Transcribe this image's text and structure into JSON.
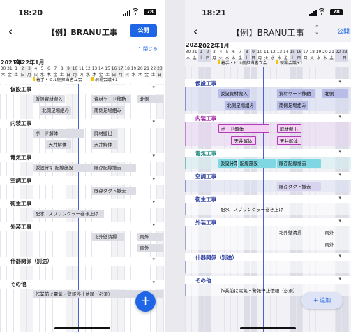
{
  "left": {
    "status_time": "18:20",
    "battery": "78",
    "title": "【例】BRANU工事",
    "publish_label": "公開",
    "close_label": "⌃ 閉じる",
    "fab_label": "+",
    "months": [
      {
        "label": "2021年",
        "col": 0
      },
      {
        "label": "2022年1月",
        "col": 2
      }
    ],
    "days": [
      "30",
      "31",
      "1",
      "2",
      "3",
      "4",
      "5",
      "6",
      "7",
      "8",
      "9",
      "10",
      "11",
      "12",
      "13",
      "14",
      "15",
      "16",
      "17",
      "18",
      "19",
      "20",
      "21",
      "22",
      "23"
    ],
    "weekdays": [
      "木",
      "金",
      "土",
      "日",
      "月",
      "火",
      "水",
      "木",
      "金",
      "土",
      "日",
      "月",
      "火",
      "水",
      "木",
      "金",
      "土",
      "日",
      "月",
      "火",
      "水",
      "木",
      "金",
      "土",
      "日"
    ],
    "weekend_cols": [
      3,
      4,
      10,
      11,
      17,
      18,
      24
    ],
    "today_col": 12,
    "events": [
      {
        "col": 5,
        "text": "着手・ビル側担当者立会"
      },
      {
        "col": 14,
        "text": "現場会議+1"
      }
    ],
    "groups": [
      {
        "name": "仮設工事"
      },
      {
        "name": "内装工事"
      },
      {
        "name": "電気工事"
      },
      {
        "name": "空調工事"
      },
      {
        "name": "衛生工事"
      },
      {
        "name": "外装工事"
      },
      {
        "name": "什器関係（別途）"
      },
      {
        "name": "その他"
      }
    ],
    "tasks": [
      {
        "label": "仮設資材搬入",
        "col": 5,
        "span": 5,
        "row": 0,
        "group": 0
      },
      {
        "label": "資材ヤード移動",
        "col": 14,
        "span": 6,
        "row": 0,
        "group": 0
      },
      {
        "label": "北側",
        "col": 21,
        "span": 4,
        "row": 0,
        "group": 0
      },
      {
        "label": "北側足場組み",
        "col": 6,
        "span": 5,
        "row": 1,
        "group": 0
      },
      {
        "label": "南側足場組み",
        "col": 14,
        "span": 5,
        "row": 1,
        "group": 0
      },
      {
        "label": "ボード解体",
        "col": 5,
        "span": 8,
        "row": 0,
        "group": 1
      },
      {
        "label": "廃材搬出",
        "col": 14,
        "span": 4,
        "row": 0,
        "group": 1
      },
      {
        "label": "天井解体",
        "col": 7,
        "span": 4,
        "row": 1,
        "group": 1
      },
      {
        "label": "天井解体",
        "col": 14,
        "span": 4,
        "row": 1,
        "group": 1
      },
      {
        "label": "仮設分電",
        "col": 5,
        "span": 3,
        "row": 0,
        "group": 2
      },
      {
        "label": "配線施設",
        "col": 8,
        "span": 6,
        "row": 0,
        "group": 2
      },
      {
        "label": "既存配線撤去",
        "col": 14,
        "span": 7,
        "row": 0,
        "group": 2
      },
      {
        "label": "既存ダクト撤去",
        "col": 14,
        "span": 7,
        "row": 0,
        "group": 3
      },
      {
        "label": "配水",
        "col": 5,
        "span": 2,
        "row": 0,
        "group": 4
      },
      {
        "label": "スプリンクラー巻き上げ",
        "col": 7,
        "span": 9,
        "row": 0,
        "group": 4
      },
      {
        "label": "北外壁清掃",
        "col": 14,
        "span": 5,
        "row": 0,
        "group": 5
      },
      {
        "label": "南外",
        "col": 21,
        "span": 4,
        "row": 0,
        "group": 5
      },
      {
        "label": "南外",
        "col": 21,
        "span": 4,
        "row": 1,
        "group": 5
      },
      {
        "label": "作業前に電気・警報停止依頼（必須）",
        "col": 5,
        "span": 20,
        "row": 0,
        "group": 7
      }
    ]
  },
  "right": {
    "status_time": "18:21",
    "battery": "78",
    "title": "【例】BRANU工事",
    "publish_label": "公開",
    "collapse_icon": "⌃⌄",
    "add_label": "+ 追加",
    "months": [
      {
        "label": "2021",
        "col": 0
      },
      {
        "label": "2022年1月",
        "col": 2
      }
    ],
    "days": [
      "30",
      "31",
      "1",
      "2",
      "3",
      "4",
      "5",
      "6",
      "7",
      "8",
      "9",
      "10",
      "11",
      "12",
      "13",
      "14",
      "15",
      "16",
      "17",
      "18",
      "19",
      "20",
      "21",
      "22",
      "23"
    ],
    "weekdays": [
      "木",
      "金",
      "土",
      "日",
      "月",
      "火",
      "水",
      "木",
      "金",
      "土",
      "日",
      "月",
      "火",
      "水",
      "木",
      "金",
      "土",
      "日",
      "月",
      "火",
      "水",
      "木",
      "金",
      "土",
      "日"
    ],
    "weekend_cols": [
      2,
      3,
      9,
      10,
      16,
      17,
      23,
      24
    ],
    "today_col": 12,
    "events": [
      {
        "col": 5,
        "text": "着手・ビル側担当者立会"
      },
      {
        "col": 14,
        "text": "現場会議+1"
      }
    ],
    "groups": [
      {
        "name": "仮設工事",
        "color": "#2b3d9e",
        "stripe": "#d6daf2"
      },
      {
        "name": "内装工事",
        "color": "#9b1fa0",
        "stripe": "#ead6f3"
      },
      {
        "name": "電気工事",
        "color": "#14857a",
        "stripe": "#d4eeee"
      },
      {
        "name": "空調工事",
        "color": "#2b3d9e",
        "stripe": "#dfe2f4"
      },
      {
        "name": "衛生工事",
        "color": "#2b3d9e",
        "stripe": "#ffffff"
      },
      {
        "name": "外装工事",
        "color": "#2b3d9e",
        "stripe": "#ffffff"
      },
      {
        "name": "什器関係（別途）",
        "color": "#2b3d9e",
        "stripe": "#ffffff"
      },
      {
        "name": "その他",
        "color": "#2b3d9e",
        "stripe": "#ffffff"
      }
    ],
    "tasks": [
      {
        "label": "仮設資材搬入",
        "col": 5,
        "span": 5,
        "row": 0,
        "group": 0,
        "style": "blue"
      },
      {
        "label": "資材ヤード移動",
        "col": 14,
        "span": 6,
        "row": 0,
        "group": 0,
        "style": "blue"
      },
      {
        "label": "北側",
        "col": 21,
        "span": 4,
        "row": 0,
        "group": 0,
        "style": "blue"
      },
      {
        "label": "北側足場組み",
        "col": 6,
        "span": 5,
        "row": 1,
        "group": 0,
        "style": "blue"
      },
      {
        "label": "南側足場組み",
        "col": 14,
        "span": 5,
        "row": 1,
        "group": 0,
        "style": "blue"
      },
      {
        "label": "ボード解体",
        "col": 5,
        "span": 8,
        "row": 0,
        "group": 1,
        "style": "pink"
      },
      {
        "label": "廃材搬出",
        "col": 14,
        "span": 4,
        "row": 0,
        "group": 1,
        "style": "pink"
      },
      {
        "label": "天井解体",
        "col": 7,
        "span": 4,
        "row": 1,
        "group": 1,
        "style": "pink"
      },
      {
        "label": "天井解体",
        "col": 14,
        "span": 4,
        "row": 1,
        "group": 1,
        "style": "pink"
      },
      {
        "label": "仮設分電",
        "col": 5,
        "span": 3,
        "row": 0,
        "group": 2,
        "style": "teal"
      },
      {
        "label": "配線施設",
        "col": 8,
        "span": 6,
        "row": 0,
        "group": 2,
        "style": "teal"
      },
      {
        "label": "既存配線撤去",
        "col": 14,
        "span": 7,
        "row": 0,
        "group": 2,
        "style": "teal"
      },
      {
        "label": "既存ダクト撤去",
        "col": 14,
        "span": 7,
        "row": 0,
        "group": 3,
        "style": "lav"
      },
      {
        "label": "配水",
        "col": 5,
        "span": 2,
        "row": 0,
        "group": 4,
        "style": "plain"
      },
      {
        "label": "スプリンクラー巻き上げ",
        "col": 7,
        "span": 9,
        "row": 0,
        "group": 4,
        "style": "plain"
      },
      {
        "label": "北外壁清掃",
        "col": 14,
        "span": 5,
        "row": 0,
        "group": 5,
        "style": "plain"
      },
      {
        "label": "南外",
        "col": 21,
        "span": 4,
        "row": 0,
        "group": 5,
        "style": "plain"
      },
      {
        "label": "南外",
        "col": 21,
        "span": 4,
        "row": 1,
        "group": 5,
        "style": "plain"
      },
      {
        "label": "作業前に電気・警報停止依頼（必須）",
        "col": 5,
        "span": 20,
        "row": 0,
        "group": 7,
        "style": "plain"
      }
    ]
  }
}
